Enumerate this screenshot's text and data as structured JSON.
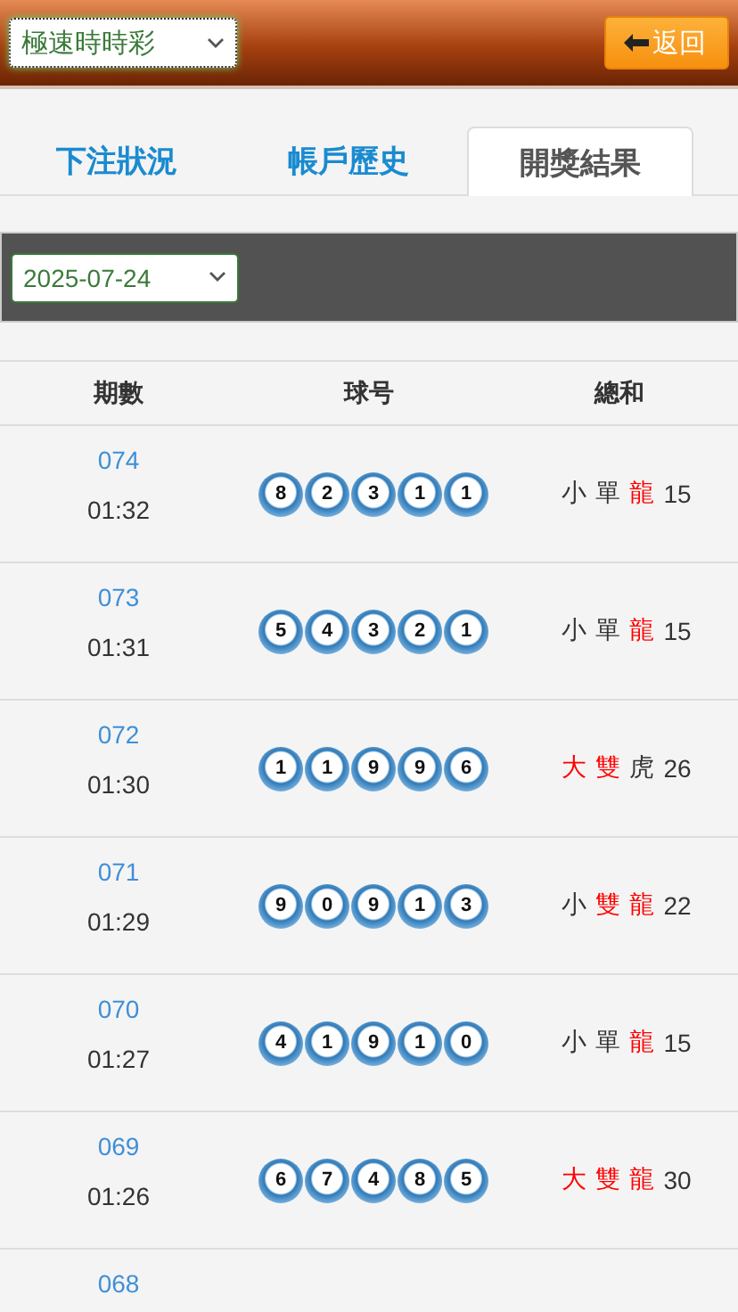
{
  "header": {
    "game_select": "極速時時彩",
    "back_button": "返回"
  },
  "tabs": [
    {
      "label": "下注狀況",
      "selected": false
    },
    {
      "label": "帳戶歷史",
      "selected": false
    },
    {
      "label": "開獎結果",
      "selected": true
    }
  ],
  "date_select": "2025-07-24",
  "table": {
    "columns": [
      "期數",
      "球号",
      "總和"
    ],
    "rows": [
      {
        "period": "074",
        "time": "01:32",
        "balls": [
          "8",
          "2",
          "3",
          "1",
          "1"
        ],
        "sum": [
          {
            "text": "小",
            "color": "#333333"
          },
          {
            "text": "單",
            "color": "#333333"
          },
          {
            "text": "龍",
            "color": "#ff0000"
          }
        ],
        "total": "15"
      },
      {
        "period": "073",
        "time": "01:31",
        "balls": [
          "5",
          "4",
          "3",
          "2",
          "1"
        ],
        "sum": [
          {
            "text": "小",
            "color": "#333333"
          },
          {
            "text": "單",
            "color": "#333333"
          },
          {
            "text": "龍",
            "color": "#ff0000"
          }
        ],
        "total": "15"
      },
      {
        "period": "072",
        "time": "01:30",
        "balls": [
          "1",
          "1",
          "9",
          "9",
          "6"
        ],
        "sum": [
          {
            "text": "大",
            "color": "#ff0000"
          },
          {
            "text": "雙",
            "color": "#ff0000"
          },
          {
            "text": "虎",
            "color": "#333333"
          }
        ],
        "total": "26"
      },
      {
        "period": "071",
        "time": "01:29",
        "balls": [
          "9",
          "0",
          "9",
          "1",
          "3"
        ],
        "sum": [
          {
            "text": "小",
            "color": "#333333"
          },
          {
            "text": "雙",
            "color": "#ff0000"
          },
          {
            "text": "龍",
            "color": "#ff0000"
          }
        ],
        "total": "22"
      },
      {
        "period": "070",
        "time": "01:27",
        "balls": [
          "4",
          "1",
          "9",
          "1",
          "0"
        ],
        "sum": [
          {
            "text": "小",
            "color": "#333333"
          },
          {
            "text": "單",
            "color": "#333333"
          },
          {
            "text": "龍",
            "color": "#ff0000"
          }
        ],
        "total": "15"
      },
      {
        "period": "069",
        "time": "01:26",
        "balls": [
          "6",
          "7",
          "4",
          "8",
          "5"
        ],
        "sum": [
          {
            "text": "大",
            "color": "#ff0000"
          },
          {
            "text": "雙",
            "color": "#ff0000"
          },
          {
            "text": "龍",
            "color": "#ff0000"
          }
        ],
        "total": "30"
      },
      {
        "period": "068"
      }
    ]
  }
}
